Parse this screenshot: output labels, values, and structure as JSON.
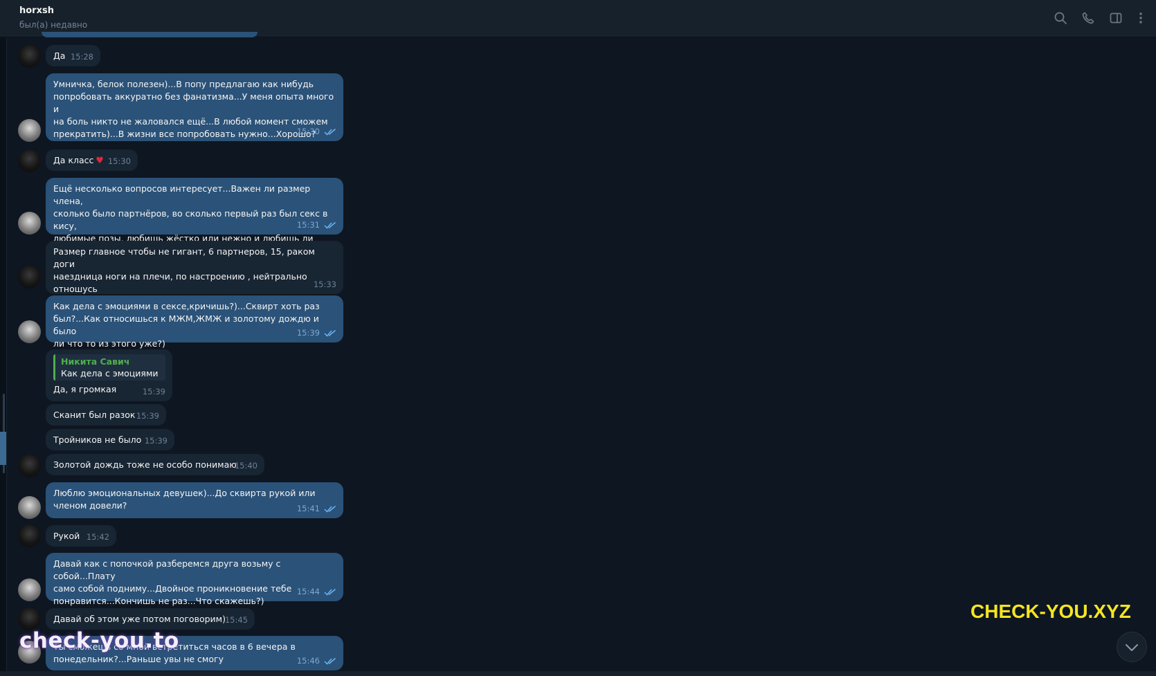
{
  "header": {
    "name": "horxsh",
    "status": "был(а) недавно",
    "icons": [
      "search-icon",
      "phone-icon",
      "sidebar-toggle-icon",
      "more-icon"
    ]
  },
  "messages": [
    {
      "text": "Да",
      "time": "15:28"
    },
    {
      "text": "Умничка, белок полезен)...В попу предлагаю как нибудь\nпопробовать аккуратно без фанатизма...У меня опыта много и\nна боль никто не жаловался ещё...В любой момент сможем\nпрекратить)...В жизни все попробовать нужно...Хорошо?",
      "time": "15:30"
    },
    {
      "text": "Да класс",
      "time": "15:30",
      "reaction": "♥"
    },
    {
      "text": "Ещё несколько вопросов интересует...Важен ли размер члена,\nсколько было партнёров, во сколько первый раз был секс в кису,\nлюбимые позы, любишь жёстко или нежно и любишь ли куни?)",
      "time": "15:31"
    },
    {
      "text": "Размер главное чтобы не гигант, 6 партнеров, 15, раком доги\nнаездница ноги на плечи,  по настроению , нейтрально\nотношусь",
      "time": "15:33"
    },
    {
      "text": "Как дела с эмоциями в сексе,кричишь?)...Сквирт хоть раз\nбыл?...Как относишься к МЖМ,ЖМЖ и золотому дождю и было\nли что то из этого уже?)",
      "time": "15:39"
    },
    {
      "reply_author": "Никита Савич",
      "reply_text": "Как дела с эмоциями ...",
      "text": "Да, я громкая",
      "time": "15:39"
    },
    {
      "text": "Сканит был разок",
      "time": "15:39"
    },
    {
      "text": "Тройников не было",
      "time": "15:39"
    },
    {
      "text": "Золотой дождь тоже не особо понимаю",
      "time": "15:40"
    },
    {
      "text": "Люблю эмоциональных девушек)...До сквирта рукой или\nчленом довели?",
      "time": "15:41"
    },
    {
      "text": "Рукой",
      "time": "15:42"
    },
    {
      "text": "Давай как с попочкой разберемся друга возьму с собой...Плату\nсамо собой подниму...Двойное проникновение тебе\nпонравится...Кончишь не раз...Что скажешь?)",
      "time": "15:44"
    },
    {
      "text": "Давай об этом уже потом поговорим)",
      "time": "15:45"
    },
    {
      "text": "Ты сможешь со мной встретиться часов в 6 вечера в\nпонедельник?...Раньше увы не смогу",
      "time": "15:46"
    }
  ],
  "watermarks": {
    "left": "check-you.to",
    "right": "CHECK-YOU.XYZ"
  }
}
